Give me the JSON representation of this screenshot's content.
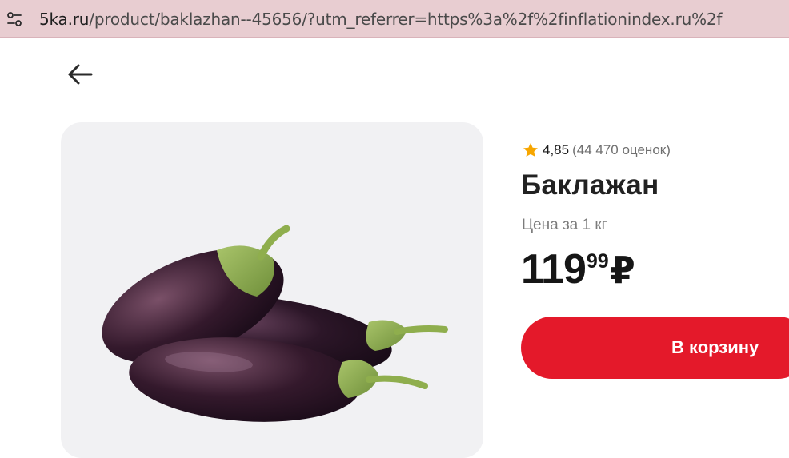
{
  "browser": {
    "url_host": "5ka.ru",
    "url_path": "/product/baklazhan--45656/?utm_referrer=https%3a%2f%2finflationindex.ru%2f"
  },
  "product": {
    "rating": "4,85",
    "ratings_count": "(44 470 оценок)",
    "title": "Баклажан",
    "unit_label": "Цена за 1 кг",
    "price_rub": "119",
    "price_kop": "99",
    "currency": "₽",
    "add_to_cart_label": "В корзину"
  },
  "colors": {
    "accent": "#e4192a",
    "star": "#f7a600",
    "addressbar": "#e8cdd1"
  },
  "icons": {
    "back": "arrow-left-icon",
    "site_info": "tune-icon",
    "rating": "star-icon"
  }
}
